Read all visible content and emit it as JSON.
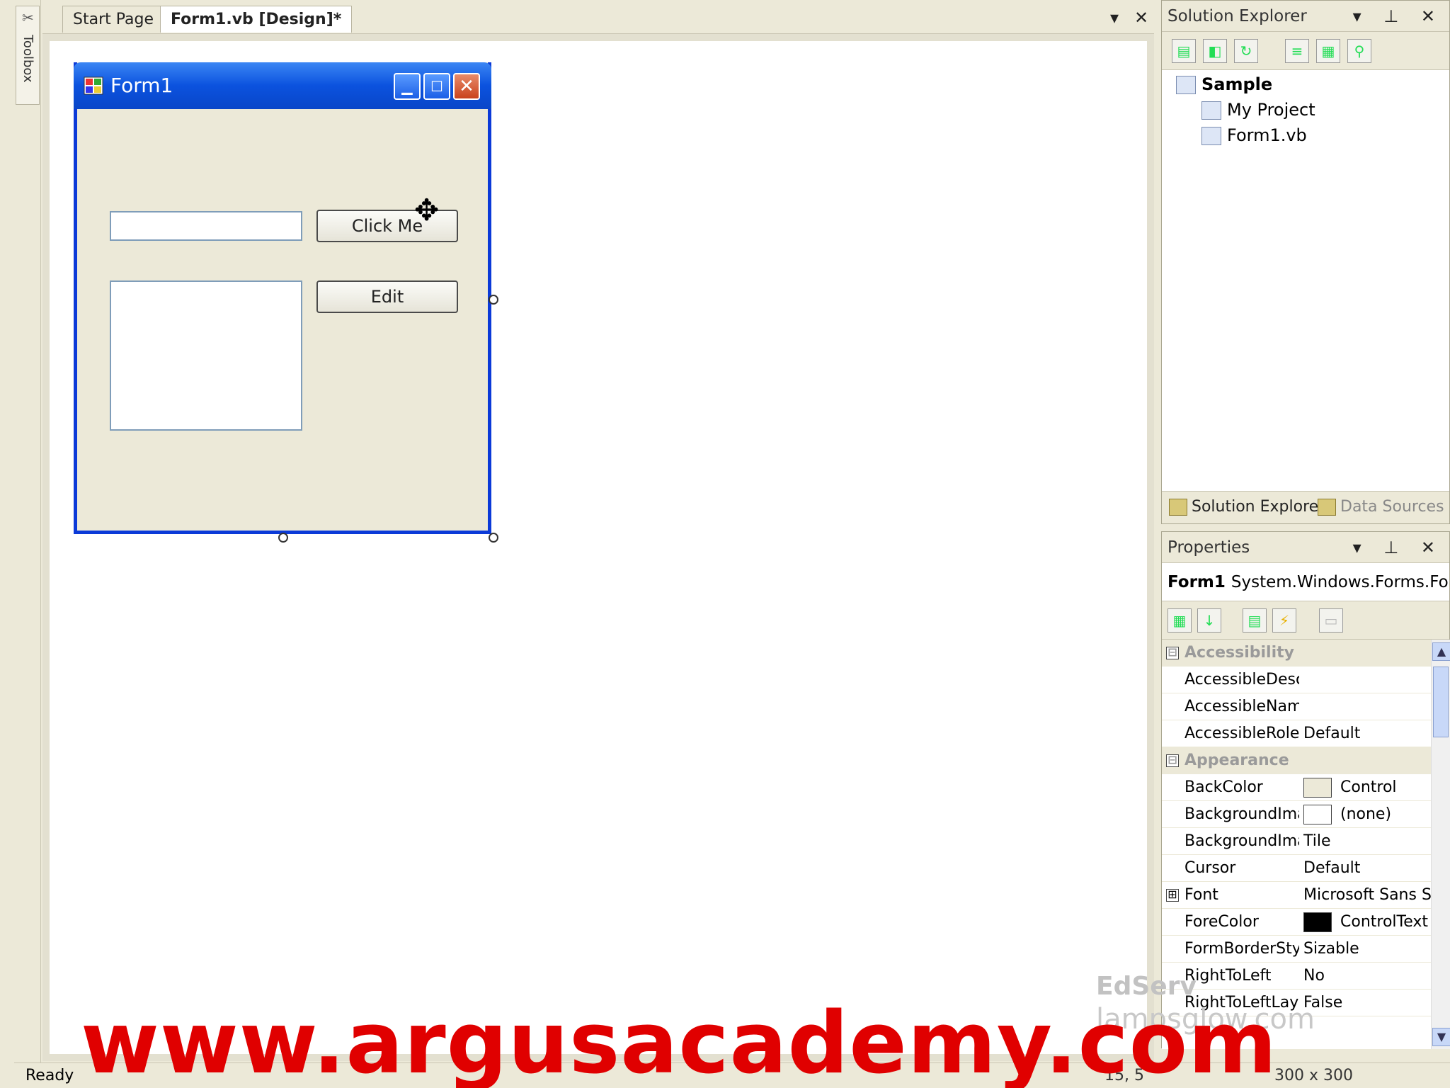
{
  "toolbox": {
    "label": "Toolbox"
  },
  "tabs": [
    {
      "label": "Start Page"
    },
    {
      "label": "Form1.vb [Design]*"
    }
  ],
  "tab_controls": {
    "dropdown": "▾",
    "close": "✕"
  },
  "designer_form": {
    "title": "Form1",
    "buttons": [
      {
        "label": "Click Me"
      },
      {
        "label": "Edit"
      }
    ],
    "caption_buttons": {
      "minimize": "▁",
      "maximize": "☐",
      "close": "✕"
    }
  },
  "solution_explorer": {
    "title": "Solution Explorer",
    "controls": "▾ ⊥ ✕",
    "tree": [
      {
        "label": "Sample",
        "bold": true
      },
      {
        "label": "My Project"
      },
      {
        "label": "Form1.vb"
      }
    ],
    "bottom_tabs": [
      {
        "label": "Solution Explorer"
      },
      {
        "label": "Data Sources"
      }
    ]
  },
  "properties": {
    "title": "Properties",
    "controls": "▾ ⊥ ✕",
    "object_name": "Form1",
    "object_type": "System.Windows.Forms.Form",
    "rows": [
      {
        "category": true,
        "expander": "⊟",
        "name": "Accessibility",
        "value": ""
      },
      {
        "name": "AccessibleDescri",
        "value": ""
      },
      {
        "name": "AccessibleName",
        "value": ""
      },
      {
        "name": "AccessibleRole",
        "value": "Default"
      },
      {
        "category": true,
        "expander": "⊟",
        "name": "Appearance",
        "value": ""
      },
      {
        "name": "BackColor",
        "value": "Control",
        "swatch": "#ece9d8"
      },
      {
        "name": "BackgroundImag",
        "value": "(none)",
        "swatch": "#ffffff"
      },
      {
        "name": "BackgroundImag",
        "value": "Tile"
      },
      {
        "name": "Cursor",
        "value": "Default"
      },
      {
        "expander": "⊞",
        "name": "Font",
        "value": "Microsoft Sans Se"
      },
      {
        "name": "ForeColor",
        "value": "ControlText",
        "swatch": "#000000"
      },
      {
        "name": "FormBorderStyle",
        "value": "Sizable"
      },
      {
        "name": "RightToLeft",
        "value": "No"
      },
      {
        "name": "RightToLeftLayo",
        "value": "False"
      }
    ]
  },
  "status": {
    "text": "Ready",
    "position": "15, 5",
    "size": "300 x 300"
  },
  "watermarks": {
    "edserv": "EdServ",
    "lampsglow": "lampsglow.com",
    "argus": "www.argusacademy.com"
  },
  "colors": {
    "title_bar": "#0b52de",
    "form_border": "#0b3ad8",
    "control_face": "#ece9d8",
    "watermark_red": "#e00000"
  }
}
